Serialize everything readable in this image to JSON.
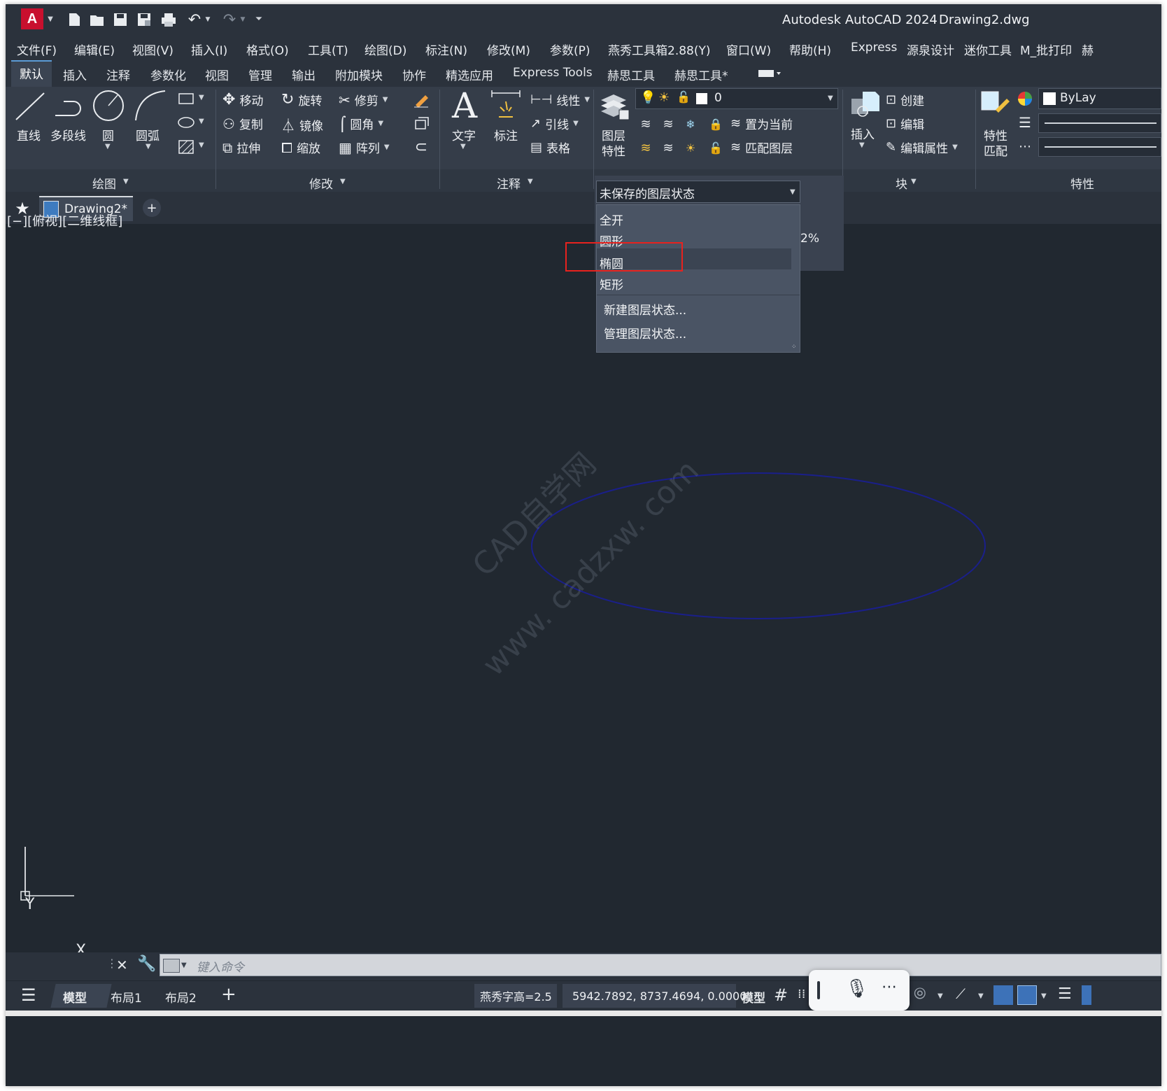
{
  "title": {
    "app": "Autodesk AutoCAD 2024",
    "file": "Drawing2.dwg",
    "logo_letter": "A"
  },
  "menu": [
    "文件(F)",
    "编辑(E)",
    "视图(V)",
    "插入(I)",
    "格式(O)",
    "工具(T)",
    "绘图(D)",
    "标注(N)",
    "修改(M)",
    "参数(P)",
    "燕秀工具箱2.88(Y)",
    "窗口(W)",
    "帮助(H)",
    "Express",
    "源泉设计",
    "迷你工具",
    "M_批打印",
    "赫"
  ],
  "ribbon_tabs": [
    "默认",
    "插入",
    "注释",
    "参数化",
    "视图",
    "管理",
    "输出",
    "附加模块",
    "协作",
    "精选应用",
    "Express Tools",
    "赫思工具",
    "赫思工具*"
  ],
  "draw_panel": {
    "line": "直线",
    "polyline": "多段线",
    "circle": "圆",
    "arc": "圆弧",
    "title": "绘图"
  },
  "modify_panel": {
    "move": "移动",
    "rotate": "旋转",
    "trim": "修剪",
    "copy": "复制",
    "mirror": "镜像",
    "fillet": "圆角",
    "stretch": "拉伸",
    "scale": "缩放",
    "array": "阵列",
    "title": "修改"
  },
  "annotation_panel": {
    "text": "文字",
    "dimension": "标注",
    "linear": "线性",
    "leader": "引线",
    "table": "表格",
    "title": "注释"
  },
  "layers_panel": {
    "properties_line1": "图层",
    "properties_line2": "特性",
    "current_layer": "0",
    "set_current": "置为当前",
    "match_layer": "匹配图层"
  },
  "block_panel": {
    "insert": "插入",
    "create": "创建",
    "edit": "编辑",
    "edit_attributes": "编辑属性",
    "title": "块"
  },
  "properties_panel": {
    "match_line1": "特性",
    "match_line2": "匹配",
    "bylayer": "ByLay",
    "title": "特性"
  },
  "doc_tab": {
    "name": "Drawing2*"
  },
  "viewport_label": "[−][俯视][二维线框]",
  "layer_state_dropdown": {
    "header": "未保存的图层状态",
    "items": [
      "全开",
      "圆形",
      "椭圆",
      "矩形"
    ],
    "highlighted": "椭圆",
    "actions": [
      "新建图层状态...",
      "管理图层状态..."
    ],
    "behind_value": "2%"
  },
  "watermark": {
    "line1": "CAD自学网",
    "line2": "www. cadzxw. com"
  },
  "ucs": {
    "x": "X",
    "y": "Y"
  },
  "command_line": {
    "placeholder": "键入命令"
  },
  "status": {
    "tabs": [
      "模型",
      "布局1",
      "布局2"
    ],
    "text_height": "燕秀字高=2.5",
    "coordinates": "5942.7892, 8737.4694, 0.0000",
    "mode": "模型"
  },
  "colors": {
    "background": "#212830",
    "ellipse": "#1a1f8a",
    "highlight_box": "#e8221e",
    "accent": "#5b9bd5"
  }
}
